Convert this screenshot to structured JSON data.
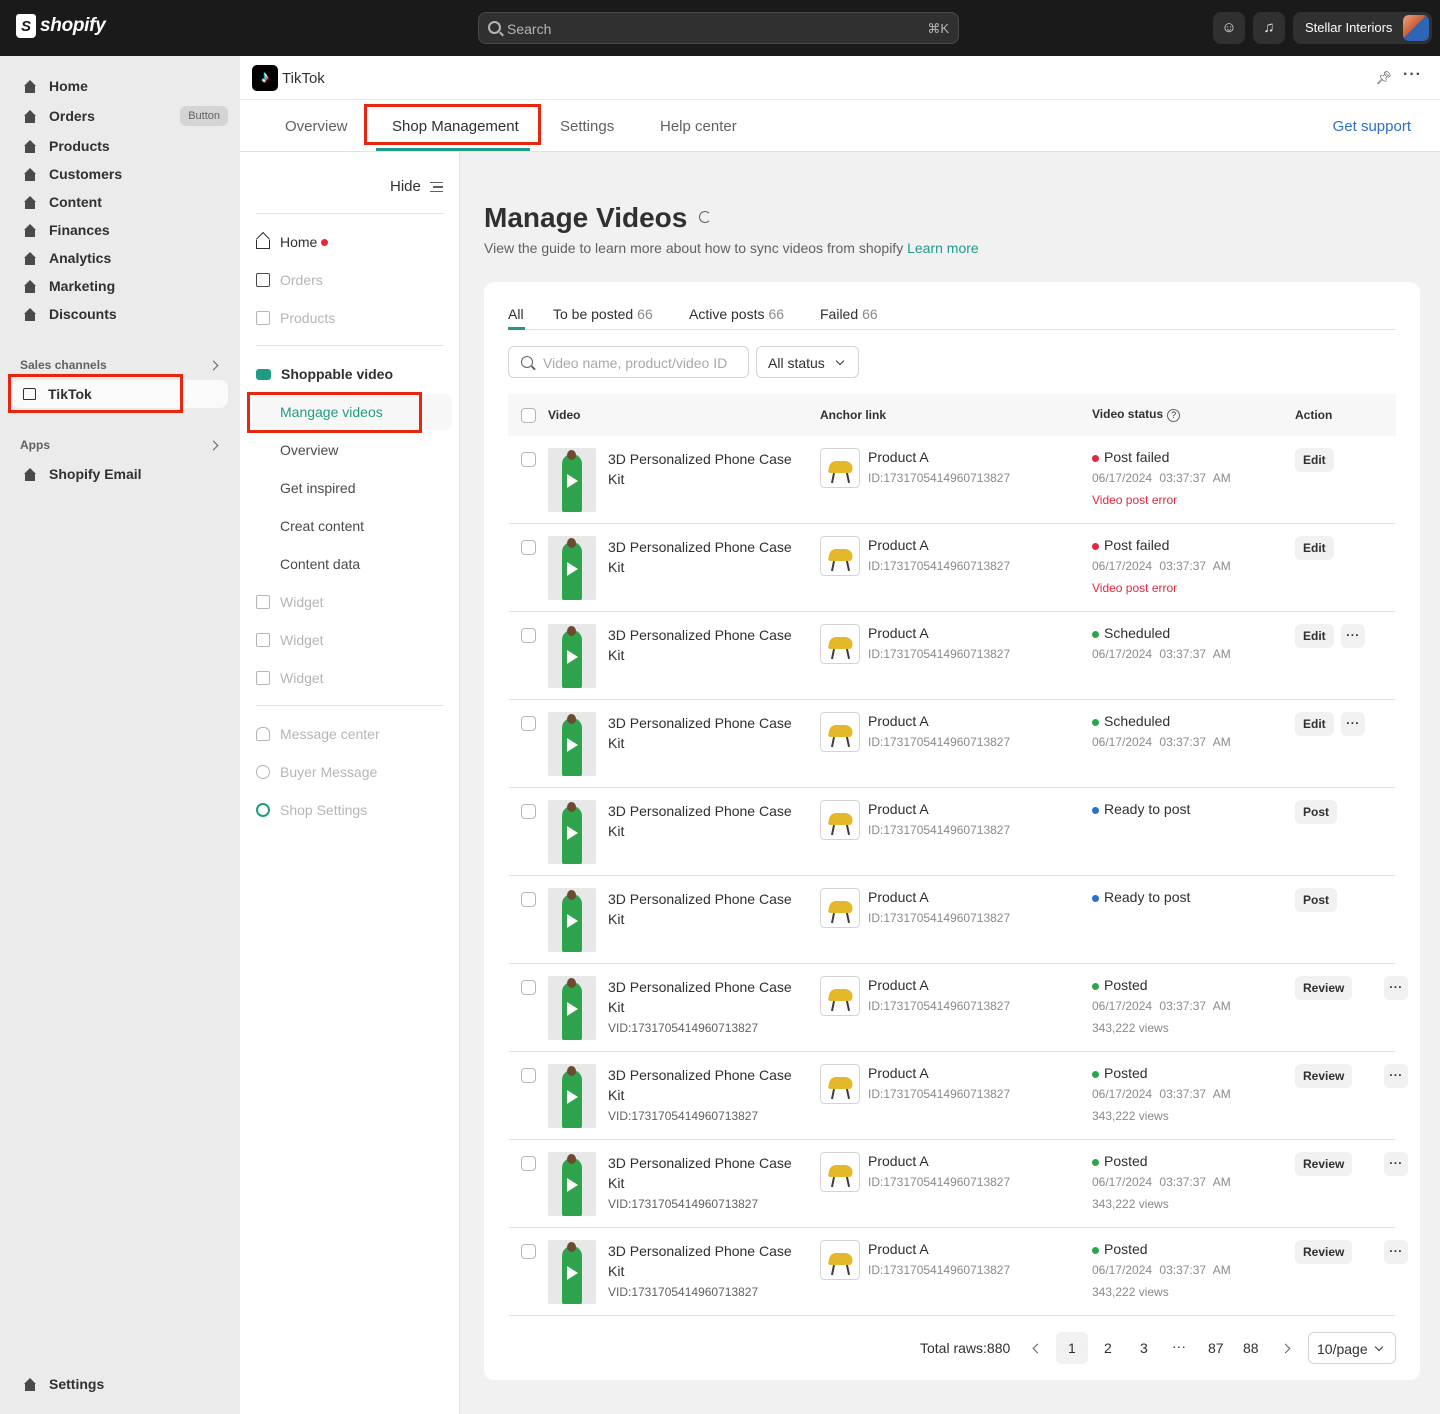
{
  "topbar": {
    "brand": "shopify",
    "search_placeholder": "Search",
    "search_shortcut": "⌘K",
    "store_name": "Stellar Interiors"
  },
  "sidebar": {
    "items": [
      {
        "label": "Home"
      },
      {
        "label": "Orders",
        "badge": "Button"
      },
      {
        "label": "Products"
      },
      {
        "label": "Customers"
      },
      {
        "label": "Content"
      },
      {
        "label": "Finances"
      },
      {
        "label": "Analytics"
      },
      {
        "label": "Marketing"
      },
      {
        "label": "Discounts"
      }
    ],
    "sales_channels_label": "Sales channels",
    "tiktok_label": "TikTok",
    "apps_label": "Apps",
    "apps_items": [
      {
        "label": "Shopify Email"
      }
    ],
    "settings_label": "Settings"
  },
  "app": {
    "title": "TikTok",
    "tabs": [
      {
        "label": "Overview"
      },
      {
        "label": "Shop Management"
      },
      {
        "label": "Settings"
      },
      {
        "label": "Help center"
      }
    ],
    "get_support": "Get support"
  },
  "subnav": {
    "hide_label": "Hide",
    "home": "Home",
    "orders": "Orders",
    "products": "Products",
    "shoppable_video": "Shoppable video",
    "active_item": "Mangage videos",
    "children": [
      "Overview",
      "Get inspired",
      "Creat content",
      "Content data"
    ],
    "widgets": [
      "Widget",
      "Widget",
      "Widget"
    ],
    "message_center": "Message center",
    "buyer_message": "Buyer Message",
    "shop_settings": "Shop Settings"
  },
  "main": {
    "title": "Manage Videos",
    "subtitle": "View the guide to learn more about how to sync videos from shopify",
    "learn_more": "Learn more",
    "filter_tabs": [
      {
        "label": "All",
        "count": ""
      },
      {
        "label": "To be posted",
        "count": "66"
      },
      {
        "label": "Active posts",
        "count": "66"
      },
      {
        "label": "Failed",
        "count": "66"
      }
    ],
    "search_placeholder": "Video name, product/video ID",
    "status_filter": "All status",
    "columns": {
      "video": "Video",
      "anchor": "Anchor link",
      "status": "Video status",
      "action": "Action"
    },
    "rows": [
      {
        "name": "3D Personalized Phone Case Kit",
        "vid": "",
        "product": "Product A",
        "pid": "ID:1731705414960713827",
        "status": "Post failed",
        "status_color": "#e5283d",
        "date": "06/17/2024 03:37:37 AM",
        "extra": "Video post error",
        "action": "Edit",
        "more": false
      },
      {
        "name": "3D Personalized Phone Case Kit",
        "vid": "",
        "product": "Product A",
        "pid": "ID:1731705414960713827",
        "status": "Post failed",
        "status_color": "#e5283d",
        "date": "06/17/2024 03:37:37 AM",
        "extra": "Video post error",
        "action": "Edit",
        "more": false
      },
      {
        "name": "3D Personalized Phone Case Kit",
        "vid": "",
        "product": "Product A",
        "pid": "ID:1731705414960713827",
        "status": "Scheduled",
        "status_color": "#29a847",
        "date": "06/17/2024 03:37:37 AM",
        "extra": "",
        "action": "Edit",
        "more": true
      },
      {
        "name": "3D Personalized Phone Case Kit",
        "vid": "",
        "product": "Product A",
        "pid": "ID:1731705414960713827",
        "status": "Scheduled",
        "status_color": "#29a847",
        "date": "06/17/2024 03:37:37 AM",
        "extra": "",
        "action": "Edit",
        "more": true
      },
      {
        "name": "3D Personalized Phone Case Kit",
        "vid": "",
        "product": "Product A",
        "pid": "ID:1731705414960713827",
        "status": "Ready to post",
        "status_color": "#2c6ecb",
        "date": "",
        "extra": "",
        "action": "Post",
        "more": false
      },
      {
        "name": "3D Personalized Phone Case Kit",
        "vid": "",
        "product": "Product A",
        "pid": "ID:1731705414960713827",
        "status": "Ready to post",
        "status_color": "#2c6ecb",
        "date": "",
        "extra": "",
        "action": "Post",
        "more": false
      },
      {
        "name": "3D Personalized Phone Case Kit",
        "vid": "VID:1731705414960713827",
        "product": "Product A",
        "pid": "ID:1731705414960713827",
        "status": "Posted",
        "status_color": "#29a847",
        "date": "06/17/2024 03:37:37 AM",
        "extra": "343,222 views",
        "action": "Review",
        "more": true
      },
      {
        "name": "3D Personalized Phone Case Kit",
        "vid": "VID:1731705414960713827",
        "product": "Product A",
        "pid": "ID:1731705414960713827",
        "status": "Posted",
        "status_color": "#29a847",
        "date": "06/17/2024 03:37:37 AM",
        "extra": "343,222 views",
        "action": "Review",
        "more": true
      },
      {
        "name": "3D Personalized Phone Case Kit",
        "vid": "VID:1731705414960713827",
        "product": "Product A",
        "pid": "ID:1731705414960713827",
        "status": "Posted",
        "status_color": "#29a847",
        "date": "06/17/2024 03:37:37 AM",
        "extra": "343,222 views",
        "action": "Review",
        "more": true
      },
      {
        "name": "3D Personalized Phone Case Kit",
        "vid": "VID:1731705414960713827",
        "product": "Product A",
        "pid": "ID:1731705414960713827",
        "status": "Posted",
        "status_color": "#29a847",
        "date": "06/17/2024 03:37:37 AM",
        "extra": "343,222 views",
        "action": "Review",
        "more": true
      }
    ],
    "pagination": {
      "total": "Total raws:880",
      "pages": [
        "1",
        "2",
        "3",
        "···",
        "87",
        "88"
      ],
      "per_page": "10/page"
    }
  }
}
